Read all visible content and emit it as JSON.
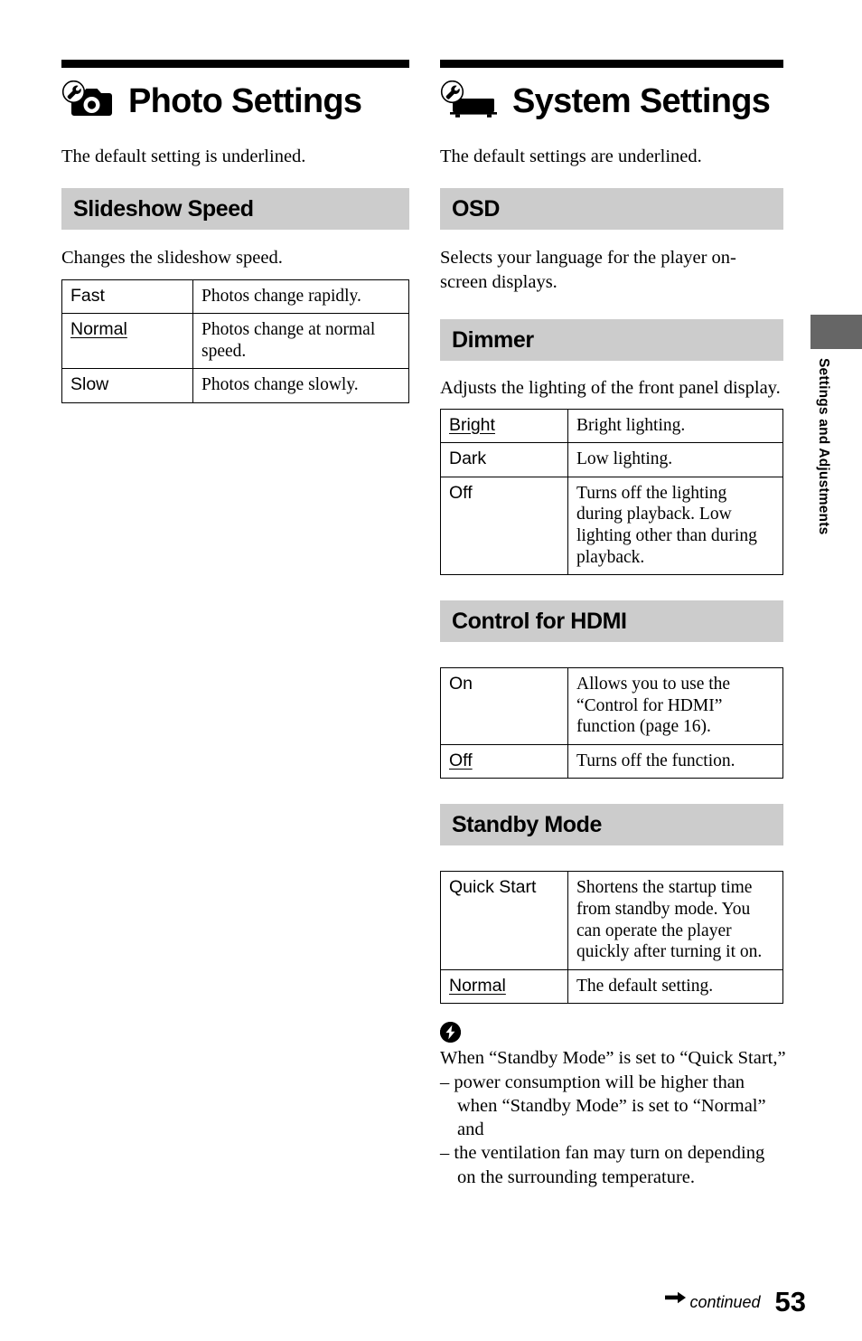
{
  "page": {
    "number": "53",
    "continued_label": "continued",
    "side_tab_label": "Settings and Adjustments"
  },
  "left_column": {
    "title": "Photo Settings",
    "icon": "camera-settings-icon",
    "intro": "The default setting is underlined.",
    "sections": [
      {
        "heading": "Slideshow Speed",
        "description": "Changes the slideshow speed.",
        "rows": [
          {
            "name": "Fast",
            "underlined": false,
            "desc": "Photos change rapidly."
          },
          {
            "name": "Normal",
            "underlined": true,
            "desc": "Photos change at normal speed."
          },
          {
            "name": "Slow",
            "underlined": false,
            "desc": "Photos change slowly."
          }
        ]
      }
    ]
  },
  "right_column": {
    "title": "System Settings",
    "icon": "player-settings-icon",
    "intro": "The default settings are underlined.",
    "sections": [
      {
        "heading": "OSD",
        "description": "Selects your language for the player on-screen displays.",
        "rows": []
      },
      {
        "heading": "Dimmer",
        "description": "Adjusts the lighting of the front panel display.",
        "rows": [
          {
            "name": "Bright",
            "underlined": true,
            "desc": "Bright lighting."
          },
          {
            "name": "Dark",
            "underlined": false,
            "desc": "Low lighting."
          },
          {
            "name": "Off",
            "underlined": false,
            "desc": "Turns off the lighting during playback. Low lighting other than during playback."
          }
        ]
      },
      {
        "heading": "Control for HDMI",
        "description": "",
        "rows": [
          {
            "name": "On",
            "underlined": false,
            "desc": "Allows you to use the “Control for HDMI” function (page 16)."
          },
          {
            "name": "Off",
            "underlined": true,
            "desc": "Turns off the function."
          }
        ]
      },
      {
        "heading": "Standby Mode",
        "description": "",
        "rows": [
          {
            "name": "Quick Start",
            "underlined": false,
            "desc": "Shortens the startup time from standby mode. You can operate the player quickly after turning it on."
          },
          {
            "name": "Normal",
            "underlined": true,
            "desc": "The default setting."
          }
        ]
      }
    ],
    "note": {
      "icon": "note-bolt-icon",
      "lead": "When “Standby Mode” is set to “Quick Start,”",
      "bullets": [
        "– power consumption will be higher than when “Standby Mode” is set to “Normal” and",
        "– the ventilation fan may turn on depending on the surrounding temperature."
      ]
    }
  }
}
